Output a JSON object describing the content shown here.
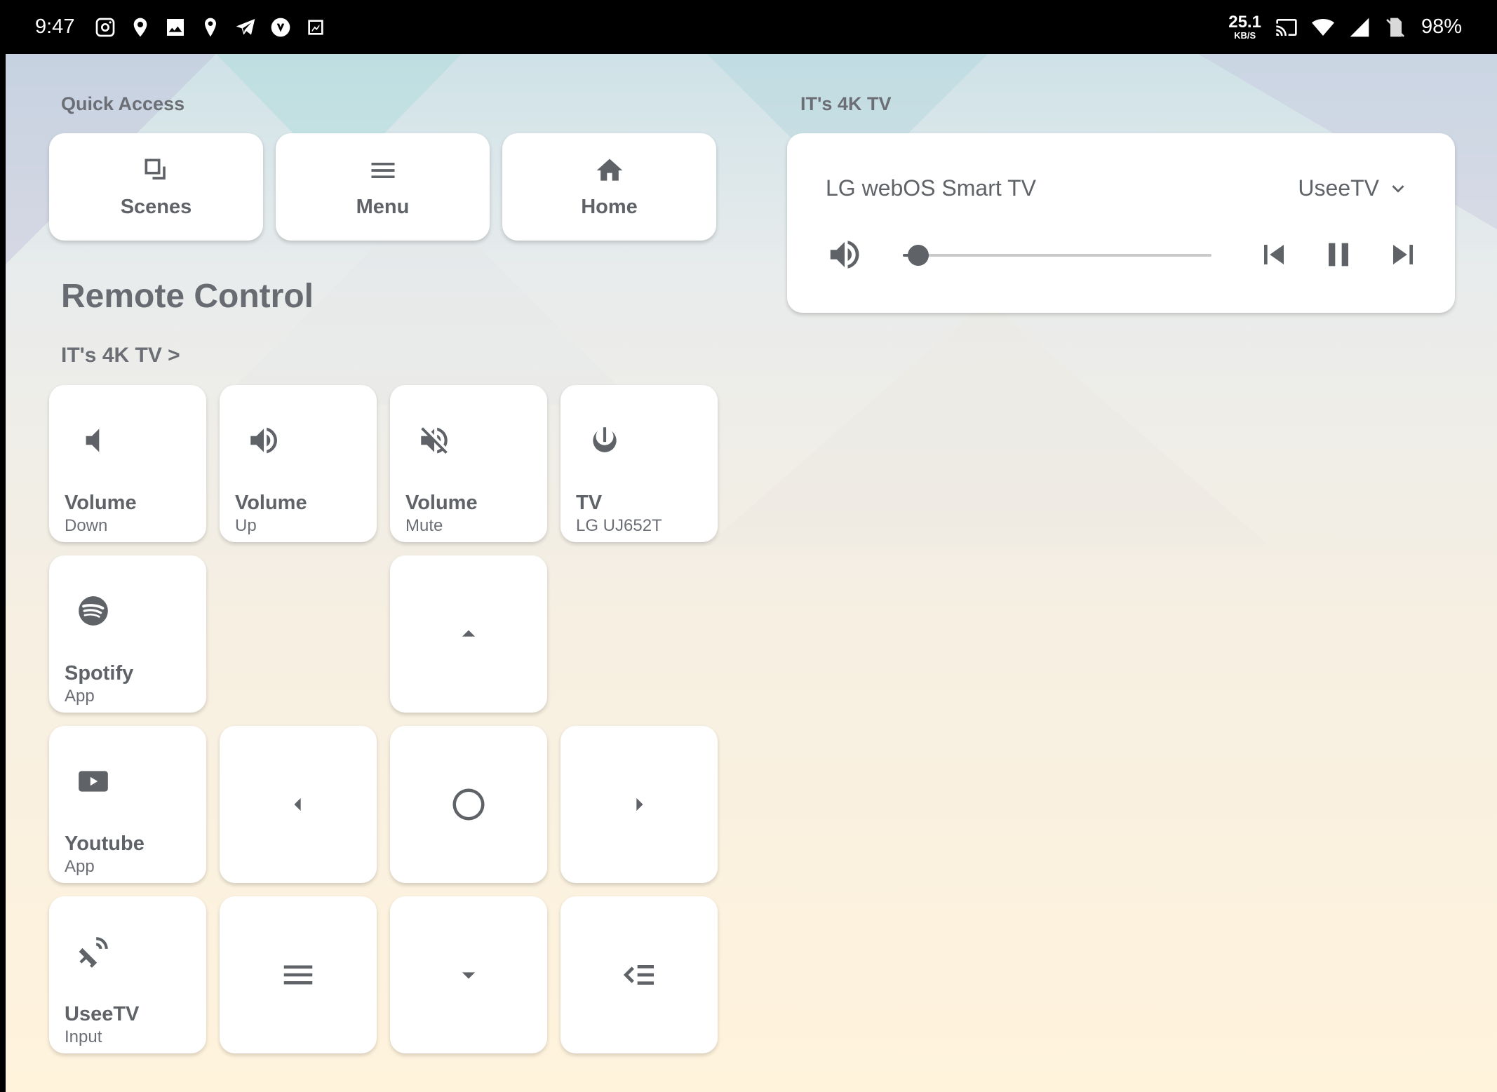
{
  "status_bar": {
    "time": "9:47",
    "notification_icons": [
      "instagram-icon",
      "maps-pin-icon",
      "image-icon",
      "location-icon",
      "telegram-icon",
      "vivaldi-icon",
      "screenshot-icon"
    ],
    "net_speed": "25.1",
    "net_unit": "KB/S",
    "battery": "98%"
  },
  "quick_access": {
    "label": "Quick Access",
    "buttons": [
      {
        "label": "Scenes",
        "icon": "scenes-icon"
      },
      {
        "label": "Menu",
        "icon": "menu-icon"
      },
      {
        "label": "Home",
        "icon": "home-icon"
      }
    ]
  },
  "remote": {
    "title": "Remote Control",
    "device_link": "IT's 4K TV >",
    "tiles": [
      {
        "name": "Volume",
        "sub": "Down",
        "icon": "volume-down-icon"
      },
      {
        "name": "Volume",
        "sub": "Up",
        "icon": "volume-up-icon"
      },
      {
        "name": "Volume",
        "sub": "Mute",
        "icon": "volume-mute-icon"
      },
      {
        "name": "TV",
        "sub": "LG UJ652T",
        "icon": "power-icon"
      },
      {
        "name": "Spotify",
        "sub": "App",
        "icon": "spotify-icon"
      },
      {
        "name": "Youtube",
        "sub": "App",
        "icon": "youtube-icon"
      },
      {
        "name": "UseeTV",
        "sub": "Input",
        "icon": "satellite-icon"
      }
    ]
  },
  "media": {
    "section_label": "IT's 4K TV",
    "device_name": "LG webOS Smart TV",
    "source": "UseeTV",
    "volume_level": 0.05
  },
  "colors": {
    "accent": "#5f6368",
    "card": "#ffffff"
  }
}
